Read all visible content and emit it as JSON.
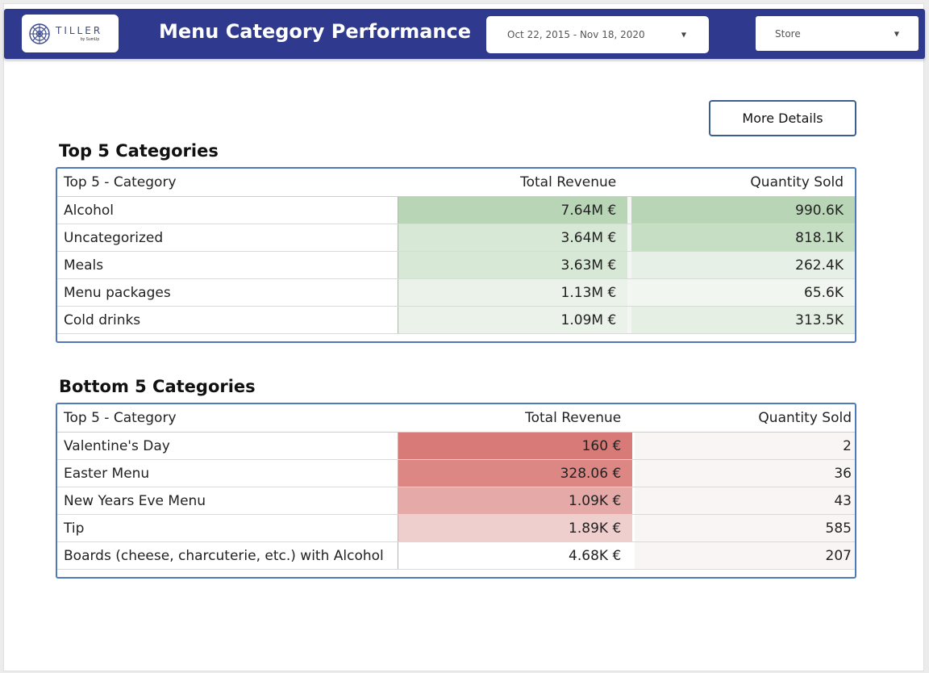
{
  "header": {
    "title": "Menu Category Performance",
    "logo_text": "TILLER",
    "logo_subtext": "by SumUp",
    "date_range": "Oct 22, 2015 - Nov 18, 2020",
    "store_label": "Store",
    "colors": {
      "bar": "#2f3a8f"
    }
  },
  "more_details_label": "More Details",
  "top": {
    "section_title": "Top 5 Categories",
    "columns": [
      "Top 5 - Category",
      "Total Revenue",
      "Quantity Sold"
    ],
    "rows": [
      {
        "category": "Alcohol",
        "revenue": "7.64M €",
        "quantity": "990.6K",
        "rev_color": "#b8d6b5",
        "qty_color": "#b8d6b5"
      },
      {
        "category": "Uncategorized",
        "revenue": "3.64M €",
        "quantity": "818.1K",
        "rev_color": "#d8e8d6",
        "qty_color": "#c6dec3"
      },
      {
        "category": "Meals",
        "revenue": "3.63M €",
        "quantity": "262.4K",
        "rev_color": "#d8e8d6",
        "qty_color": "#e7f0e6"
      },
      {
        "category": "Menu packages",
        "revenue": "1.13M €",
        "quantity": "65.6K",
        "rev_color": "#eaf2e9",
        "qty_color": "#f1f6f0"
      },
      {
        "category": "Cold drinks",
        "revenue": "1.09M €",
        "quantity": "313.5K",
        "rev_color": "#eaf2e9",
        "qty_color": "#e5efe4"
      }
    ]
  },
  "bottom": {
    "section_title": "Bottom 5 Categories",
    "columns": [
      "Top 5 - Category",
      "Total Revenue",
      "Quantity Sold"
    ],
    "rows": [
      {
        "category": "Valentine's Day",
        "revenue": "160 €",
        "quantity": "2",
        "rev_color": "#d87b78",
        "qty_color": "#faf5f5"
      },
      {
        "category": "Easter Menu",
        "revenue": "328.06 €",
        "quantity": "36",
        "rev_color": "#dc8784",
        "qty_color": "#faf5f5"
      },
      {
        "category": "New Years Eve Menu",
        "revenue": "1.09K €",
        "quantity": "43",
        "rev_color": "#e5a9a7",
        "qty_color": "#faf5f5"
      },
      {
        "category": "Tip",
        "revenue": "1.89K €",
        "quantity": "585",
        "rev_color": "#efcfce",
        "qty_color": "#faf5f5"
      },
      {
        "category": "Boards (cheese, charcuterie, etc.) with Alcohol",
        "revenue": "4.68K €",
        "quantity": "207",
        "rev_color": "#ffffff",
        "qty_color": "#faf5f5"
      }
    ]
  }
}
